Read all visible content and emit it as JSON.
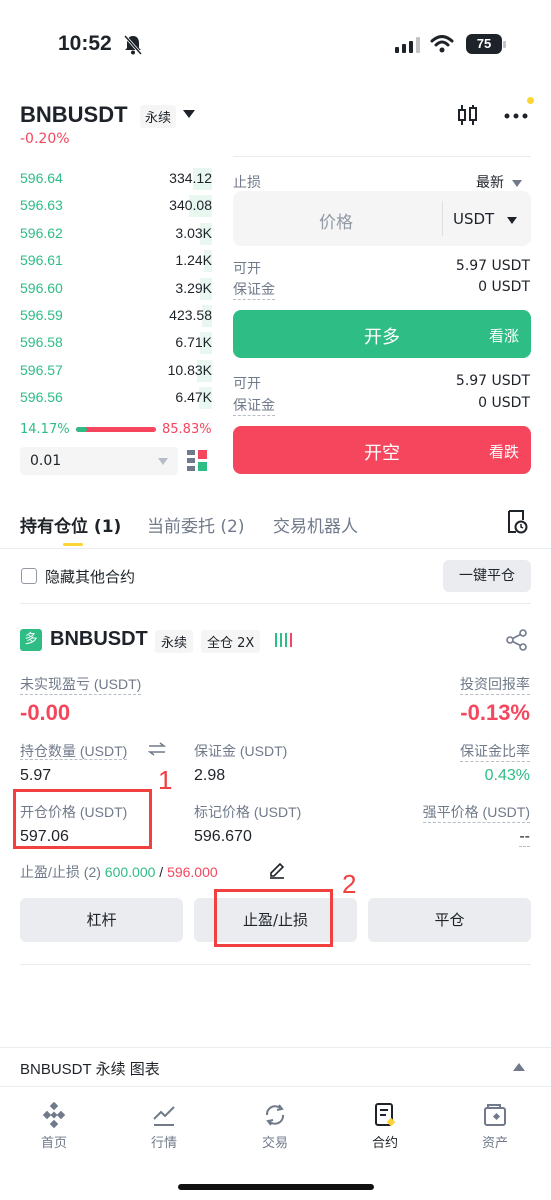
{
  "status_bar": {
    "time": "10:52",
    "battery": "75"
  },
  "header": {
    "symbol": "BNBUSDT",
    "perp_tag": "永续",
    "change": "-0.20%"
  },
  "order_book": {
    "rows": [
      {
        "price": "596.64",
        "qty": "334.12",
        "depth": 0.1
      },
      {
        "price": "596.63",
        "qty": "340.08",
        "depth": 0.12
      },
      {
        "price": "596.62",
        "qty": "3.03K",
        "depth": 0.06
      },
      {
        "price": "596.61",
        "qty": "1.24K",
        "depth": 0.04
      },
      {
        "price": "596.60",
        "qty": "3.29K",
        "depth": 0.06
      },
      {
        "price": "596.59",
        "qty": "423.58",
        "depth": 0.05
      },
      {
        "price": "596.58",
        "qty": "6.71K",
        "depth": 0.06
      },
      {
        "price": "596.57",
        "qty": "10.83K",
        "depth": 0.08
      },
      {
        "price": "596.56",
        "qty": "6.47K",
        "depth": 0.07
      }
    ],
    "buy_ratio": "14.17%",
    "sell_ratio": "85.83%",
    "buy_fraction": 0.1417,
    "precision": "0.01"
  },
  "order_form": {
    "stop_label": "止损",
    "type_label": "最新",
    "price_placeholder": "价格",
    "currency": "USDT",
    "available_label": "可开",
    "margin_label": "保证金",
    "long_available": "5.97 USDT",
    "long_margin": "0 USDT",
    "long_button": "开多",
    "long_sub": "看涨",
    "short_available": "5.97 USDT",
    "short_margin": "0 USDT",
    "short_button": "开空",
    "short_sub": "看跌"
  },
  "tabs": {
    "positions": "持有仓位 (1)",
    "open_orders": "当前委托 (2)",
    "bots": "交易机器人"
  },
  "filters": {
    "hide_others": "隐藏其他合约",
    "close_all": "一键平仓"
  },
  "position": {
    "badge": "多",
    "symbol": "BNBUSDT",
    "perp_tag": "永续",
    "margin_mode": "全仓 2X",
    "unrealized_label": "未实现盈亏 (USDT)",
    "unrealized_value": "-0.00",
    "roi_label": "投资回报率",
    "roi_value": "-0.13%",
    "size_label": "持仓数量 (USDT)",
    "size_value": "5.97",
    "margin_label": "保证金 (USDT)",
    "margin_value": "2.98",
    "margin_ratio_label": "保证金比率",
    "margin_ratio_value": "0.43%",
    "entry_label": "开仓价格 (USDT)",
    "entry_value": "597.06",
    "mark_label": "标记价格 (USDT)",
    "mark_value": "596.670",
    "liq_label": "强平价格 (USDT)",
    "liq_value": "--",
    "tpsl_label": "止盈/止损 (2)",
    "tp_value": "600.000",
    "separator": "/",
    "sl_value": "596.000",
    "btn_leverage": "杠杆",
    "btn_tpsl": "止盈/止损",
    "btn_close": "平仓"
  },
  "annotations": {
    "one": "1",
    "two": "2"
  },
  "chart_bar": {
    "label": "BNBUSDT 永续 图表"
  },
  "nav": [
    {
      "label": "首页"
    },
    {
      "label": "行情"
    },
    {
      "label": "交易"
    },
    {
      "label": "合约"
    },
    {
      "label": "资产"
    }
  ],
  "colors": {
    "green": "#2ebd85",
    "red": "#f6465d",
    "yellow": "#fcd535"
  }
}
